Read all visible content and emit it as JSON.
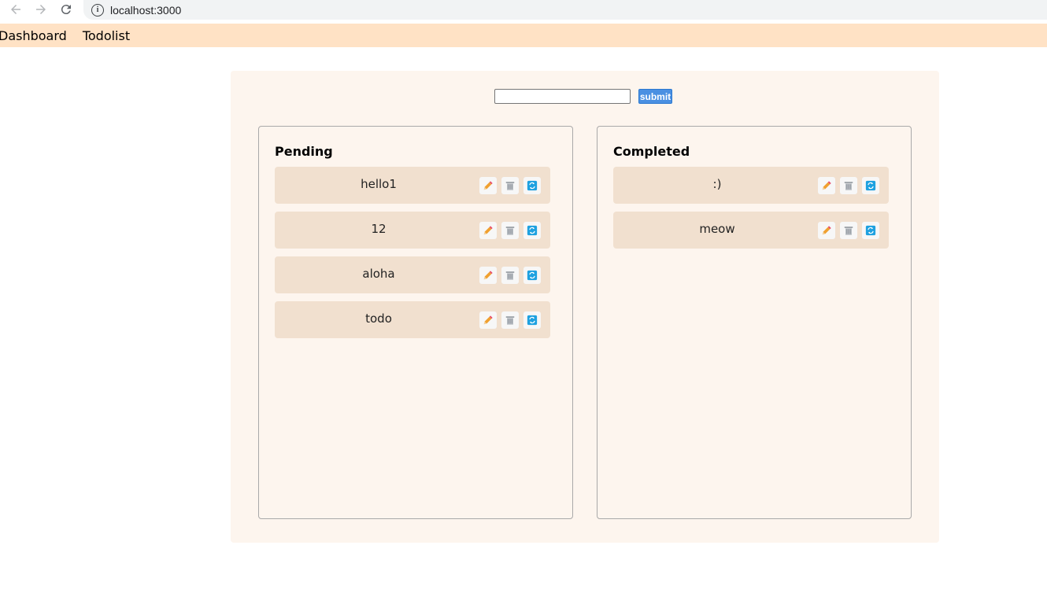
{
  "browser": {
    "url": "localhost:3000",
    "icons": [
      "back-arrow-icon",
      "forward-arrow-icon",
      "reload-icon",
      "info-icon"
    ]
  },
  "nav": {
    "dashboard": "Dashboard",
    "todolist": "Todolist"
  },
  "form": {
    "input_value": "",
    "submit_label": "submit"
  },
  "pending": {
    "title": "Pending",
    "items": [
      "hello1",
      "12",
      "aloha",
      "todo"
    ]
  },
  "completed": {
    "title": "Completed",
    "items": [
      ":)",
      "meow"
    ]
  },
  "item_actions": [
    "pencil-icon",
    "trash-icon",
    "toggle-status-icon"
  ],
  "colors": {
    "nav_bg": "#ffe2c5",
    "panel_bg": "#fdf5ee",
    "item_bg": "#f1e0cf",
    "submit_bg": "#4a90e2",
    "toggle_icon": "#1ea1e0"
  }
}
